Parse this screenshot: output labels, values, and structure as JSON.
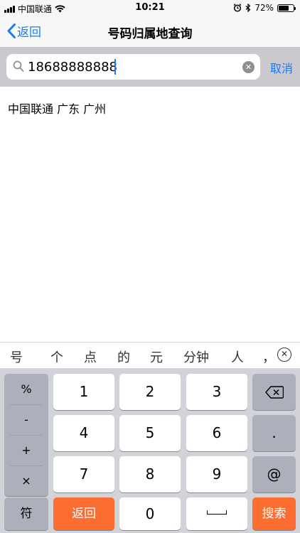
{
  "status_bar": {
    "carrier": "中国联通",
    "time": "10:21",
    "battery": "72%",
    "battery_level": 0.72
  },
  "nav": {
    "back_label": "返回",
    "title": "号码归属地查询"
  },
  "search": {
    "value": "18688888888",
    "cancel_label": "取消"
  },
  "results": [
    "中国联通 广东 广州"
  ],
  "suggestions": [
    "号",
    "个",
    "点",
    "的",
    "元",
    "分钟",
    "人",
    "，"
  ],
  "keyboard": {
    "symbols": [
      "%",
      "-",
      "+",
      "×"
    ],
    "digits": [
      "1",
      "2",
      "3",
      "4",
      "5",
      "6",
      "7",
      "8",
      "9",
      "0"
    ],
    "dot": ".",
    "at": "@",
    "symbol_key": "符",
    "return_key": "返回",
    "search_key": "搜索"
  },
  "colors": {
    "accent": "#1a7cf2",
    "orange": "#fb6d31"
  }
}
